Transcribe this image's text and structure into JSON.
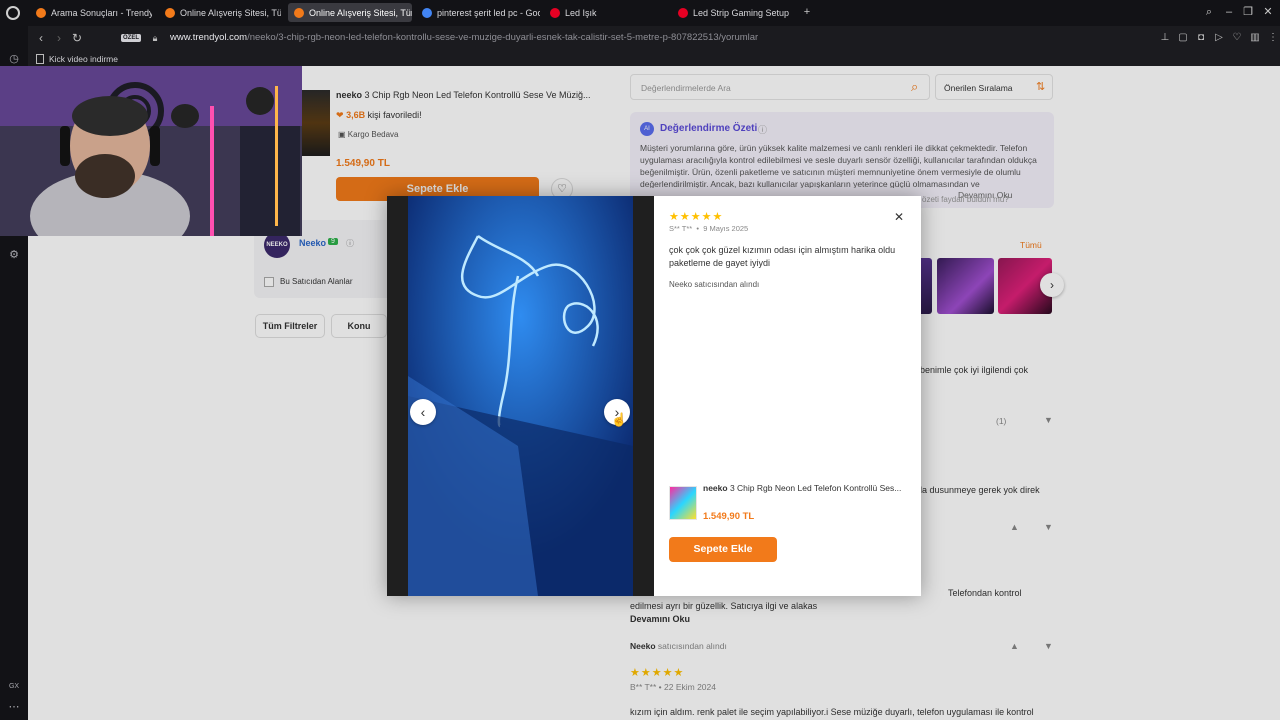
{
  "browser": {
    "tabs": [
      {
        "label": "Arama Sonuçları - Trendyo",
        "color": "#f27a1a"
      },
      {
        "label": "Online Alışveriş Sitesi, Tür",
        "color": "#f27a1a"
      },
      {
        "label": "Online Alışveriş Sitesi, Tür",
        "color": "#f27a1a"
      },
      {
        "label": "pinterest şerit led pc - Goo",
        "color": "#4285f4"
      },
      {
        "label": "Led Işık",
        "color": "#e60023"
      },
      {
        "label": "Led Strip Gaming Setup",
        "color": "#e60023"
      }
    ],
    "private_badge": "ÖZEL",
    "url_domain": "www.trendyol.com",
    "url_path": "/neeko/3-chip-rgb-neon-led-telefon-kontrollu-sese-ve-muzige-duyarli-esnek-tak-calistir-set-5-metre-p-807822513/yorumlar",
    "bookmark": "Kick video indirme"
  },
  "product": {
    "brand": "neeko",
    "title": " 3 Chip Rgb Neon Led Telefon Kontrollü Sese Ve Müziğ...",
    "favorites_count": "3,6B",
    "favorites_suffix": " kişi favoriledi!",
    "shipping": "Kargo Bedava",
    "price": "1.549,90 TL",
    "add_to_cart": "Sepete Ekle"
  },
  "seller": {
    "logo": "NEEKO",
    "name": "Neeko",
    "score": "9",
    "checkbox_label": "Bu Satıcıdan Alanlar"
  },
  "filters": {
    "all": "Tüm Filtreler",
    "topic": "Konu"
  },
  "reviews_panel": {
    "search_placeholder": "Değerlendirmelerde Ara",
    "sort": "Önerilen Sıralama",
    "summary_title": "Değerlendirme Özeti",
    "summary_text": "Müşteri yorumlarına göre, ürün yüksek kalite malzemesi ve canlı renkleri ile dikkat çekmektedir. Telefon uygulaması aracılığıyla kontrol edilebilmesi ve sesle duyarlı sensör özelliği, kullanıcılar tarafından oldukça beğenilmiştir. Ürün, özenli paketleme ve satıcının müşteri memnuniyetine önem vermesiyle de olumlu değerlendirilmiştir. Ancak, bazı kullanıcılar yapışkanların yeterince güçlü olmamasından ve",
    "summary_faded": "özeti faydalı buldun mu?",
    "read_more": "Devamını Oku",
    "all_link": "Tümü",
    "partial_1": "ıcı benimle çok iyi ilgilendi çok",
    "like_count_1": "(1)",
    "partial_2": "fazla dusunmeye gerek yok direk",
    "review_3_text": "Telefondan kontrol",
    "review_3_text2": "edilmesi ayrı bir güzellik. Satıcıya ilgi ve alakas",
    "review_3_more": "Devamını Oku",
    "review_3_seller": "Neeko",
    "review_3_seller_suffix": " satıcısından alındı",
    "review_4_author": "B** T**",
    "review_4_date": "22 Ekim 2024",
    "review_4_text": "kızım için aldım. renk palet ile seçim yapılabiliyor.i Sese müziğe duyarlı, telefon uygulaması ile kontrol"
  },
  "modal": {
    "author": "S** T**",
    "date": "9 Mayıs 2025",
    "review": "çok çok çok güzel kızımın odası için almıştım harika oldu paketleme de gayet iyiydi",
    "seller_note": "Neeko satıcısından alındı",
    "product_brand": "neeko",
    "product_title": " 3 Chip Rgb Neon Led Telefon Kontrollü Ses...",
    "price": "1.549,90 TL",
    "add_to_cart": "Sepete Ekle",
    "rating": 5
  },
  "sidebar": {
    "gx_label": "GX"
  }
}
